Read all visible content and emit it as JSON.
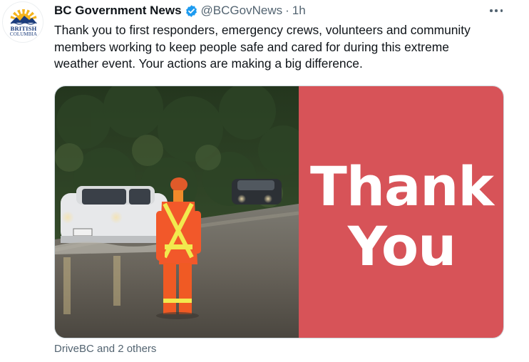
{
  "account": {
    "display_name": "BC Government News",
    "handle": "@BCGovNews",
    "separator": "·",
    "timestamp": "1h",
    "verified": true,
    "avatar_text_line1": "BRITISH",
    "avatar_text_line2": "COLUMBIA"
  },
  "tweet": {
    "text": "Thank you to first responders, emergency crews, volunteers and community\nmembers working to keep people safe and cared for during this extreme\nweather event. Your actions are making a big difference."
  },
  "media": {
    "panel_line1": "Thank",
    "panel_line2": "You",
    "panel_color": "#d75358"
  },
  "tags": {
    "text": "DriveBC and 2 others"
  },
  "icons": {
    "verified": "verified-badge-icon",
    "more": "more-options-icon"
  },
  "colors": {
    "text_primary": "#0f1419",
    "text_secondary": "#536471",
    "verified_blue": "#1d9bf0"
  }
}
